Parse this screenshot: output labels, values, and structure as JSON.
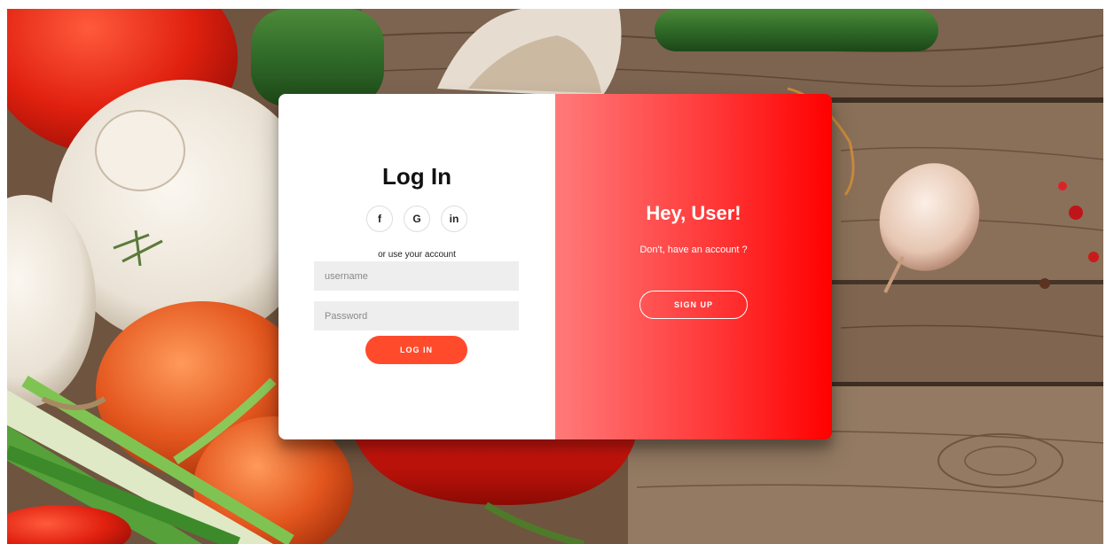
{
  "login": {
    "title": "Log In",
    "social": {
      "facebook": "f",
      "google": "G",
      "linkedin": "in"
    },
    "use_account_text": "or use your account",
    "username_placeholder": "username",
    "password_placeholder": "Password",
    "login_button": "LOG IN"
  },
  "overlay": {
    "title": "Hey, User!",
    "subtitle": "Don't, have an account ?",
    "signup_button": "SIGN UP"
  },
  "colors": {
    "login_button": "#ff4b2b",
    "overlay_start": "#ff7a7a",
    "overlay_end": "#ff0000"
  }
}
